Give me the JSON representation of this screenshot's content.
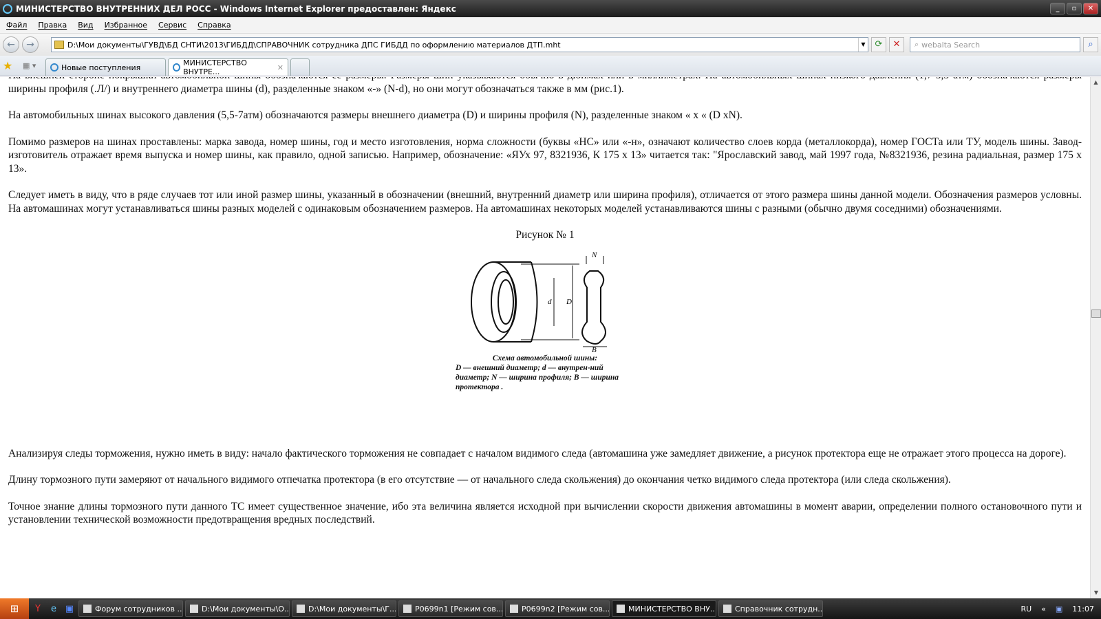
{
  "window": {
    "title": "МИНИСТЕРСТВО ВНУТРЕННИХ ДЕЛ РОСС - Windows Internet Explorer предоставлен: Яндекс"
  },
  "menu": [
    "Файл",
    "Правка",
    "Вид",
    "Избранное",
    "Сервис",
    "Справка"
  ],
  "address": "D:\\Мои документы\\ГУВД\\БД СНТИ\\2013\\ГИБДД\\СПРАВОЧНИК сотрудника ДПС ГИБДД по оформлению материалов ДТП.mht",
  "search": {
    "placeholder": "webalta Search"
  },
  "tabs": [
    {
      "label": "Новые поступления"
    },
    {
      "label": "МИНИСТЕРСТВО ВНУТРЕ..."
    }
  ],
  "content": {
    "p0": "На внешней стороне покрышки автомобильной шины обозначаются ее размеры. Размеры шин указываются обычно в дюймах или в миллиметрах. На автомобильных шинах низкого давления (1,7-5,5 атм) обозначаются размеры ширины профиля (.Л/) и внутреннего диаметра шины (d), разделенные знаком «-» (N-d), но они могут обозначаться также в мм (рис.1).",
    "p1": "На автомобильных шинах высокого давления (5,5-7атм) обозначаются размеры внешнего диаметра (D) и ширины профиля (N), разделенные знаком « х « (D хN).",
    "p2": "Помимо размеров на шинах проставлены: марка завода, номер шины, год и место изготовления, норма сложности (буквы «НС» или «-н», означают количество слоев корда (металлокорда), номер ГОСТа или ТУ, модель шины. Завод-изготовитель отражает время выпуска и номер шины, как правило, одной записью. Например, обозначение: «ЯУх 97, 8321936, К 175 х 13» читается так: \"Ярославский завод, май 1997 года, №8321936, резина радиальная, размер 175 х 13».",
    "p3": "Следует иметь в виду, что в ряде случаев тот или иной размер шины, указанный в обозначении (внешний, внутренний диаметр или ширина профиля), отличается от этого размера шины данной модели. Обозначения размеров условны. На автомашинах могут устанавливаться шины разных моделей с одинаковым обозначением размеров. На автомашинах некоторых моделей устанавливаются шины с разными (обычно двумя соседними) обозначениями.",
    "figure_title": "Рисунок № 1",
    "figure_labels": {
      "N": "N",
      "B": "B",
      "D": "D",
      "d": "d"
    },
    "caption1": "Схема автомобильной шины:",
    "caption2": "D — внешний диаметр; d — внутрен-ний диаметр; N — ширина профиля; B — ширина протектора .",
    "p4": "Анализируя следы торможения, нужно иметь в виду: начало фактического торможения не совпадает с началом видимого следа (автомашина уже замедляет движение, а рисунок протектора еще не отражает этого процесса на дороге).",
    "p5": "Длину тормозного пути замеряют от начального видимого отпечатка протектора (в его отсутствие — от начального следа скольжения) до окончания четко видимого следа протектора (или следа скольжения).",
    "p6": "Точное знание длины тормозного пути данного ТС имеет существенное значение, ибо эта величина является исходной при вычислении скорости движения автомашины в момент аварии, определении полного остановочного пути и установлении технической возможности предотвращения вредных последствий."
  },
  "taskbar": {
    "items": [
      "Форум сотрудников ...",
      "D:\\Мои документы\\О...",
      "D:\\Мои документы\\Г...",
      "P0699n1 [Режим сов...",
      "P0699n2 [Режим сов...",
      "МИНИСТЕРСТВО ВНУ...",
      "Справочник сотрудн..."
    ],
    "lang": "RU",
    "clock": "11:07"
  }
}
